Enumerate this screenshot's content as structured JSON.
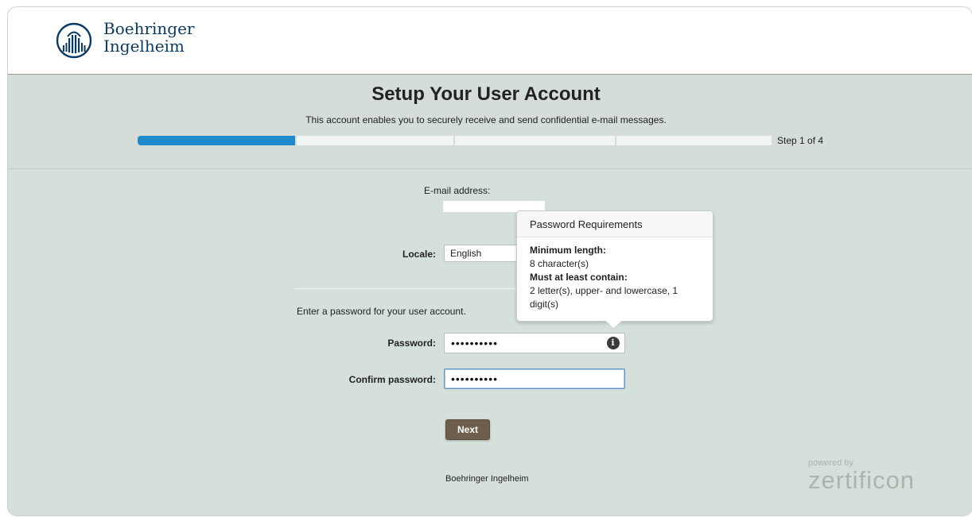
{
  "brand": {
    "line1": "Boehringer",
    "line2": "Ingelheim"
  },
  "page": {
    "title": "Setup Your User Account",
    "subtitle": "This account enables you to securely receive and send confidential e-mail messages."
  },
  "progress": {
    "current_step": 1,
    "total_steps": 4,
    "label": "Step 1 of 4"
  },
  "form": {
    "email_label": "E-mail address:",
    "locale_label": "Locale:",
    "locale_value": "English",
    "password_prompt": "Enter a password for your user account.",
    "password_label": "Password:",
    "password_value": "••••••••••",
    "confirm_label": "Confirm password:",
    "confirm_value": "••••••••••",
    "next_label": "Next"
  },
  "tooltip": {
    "title": "Password Requirements",
    "min_length_heading": "Minimum length:",
    "min_length_value": "8 character(s)",
    "contain_heading": "Must at least contain:",
    "contain_value": "2 letter(s), upper- and lowercase, 1 digit(s)"
  },
  "footer": {
    "company": "Boehringer Ingelheim",
    "powered_by": "powered by",
    "vendor": "zertificon"
  },
  "icons": {
    "info": "info-icon",
    "logo": "logo-icon"
  },
  "colors": {
    "progress": "#1f8acb",
    "button": "#6f5e4c",
    "band": "#d6e0da"
  }
}
